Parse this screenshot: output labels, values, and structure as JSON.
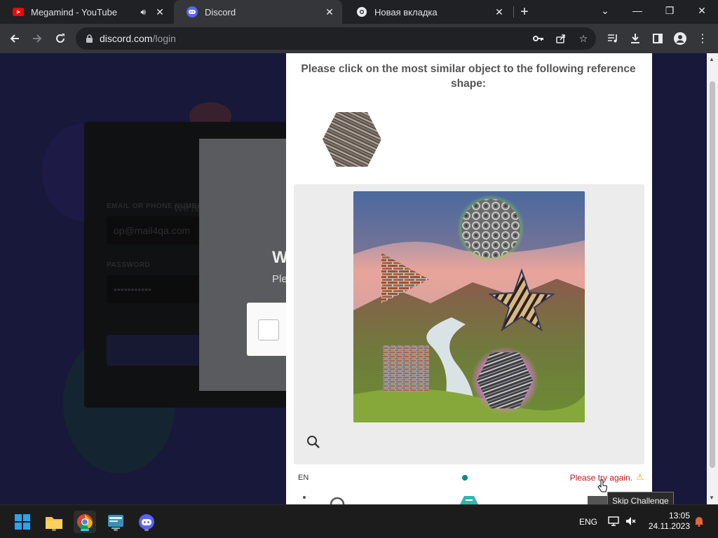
{
  "browser": {
    "tabs": [
      {
        "title": "Megamind - YouTube",
        "favicon": "youtube-icon",
        "audio": true
      },
      {
        "title": "Discord",
        "favicon": "discord-icon",
        "active": true
      },
      {
        "title": "Новая вкладка",
        "favicon": "chrome-icon"
      }
    ],
    "url_host": "discord.com",
    "url_path": "/login"
  },
  "discord_bg": {
    "email_label": "EMAIL OR PHONE NUMBER",
    "email_value": "op@mail4qa.com",
    "password_label": "PASSWORD",
    "password_value": "•••••••••••",
    "welcome_partial": "W",
    "subtitle_partial": "Ple",
    "tagline_partial": "We're"
  },
  "captcha": {
    "prompt": "Please click on the most similar object to the following reference shape:",
    "language": "EN",
    "error": "Please try again.",
    "tooltip": "Skip Challenge"
  },
  "taskbar": {
    "language": "ENG",
    "time": "13:05",
    "date": "24.11.2023"
  },
  "colors": {
    "error": "#bf1722",
    "accent_teal": "#0b8a8a",
    "page_bg": "#2b2d6b"
  }
}
